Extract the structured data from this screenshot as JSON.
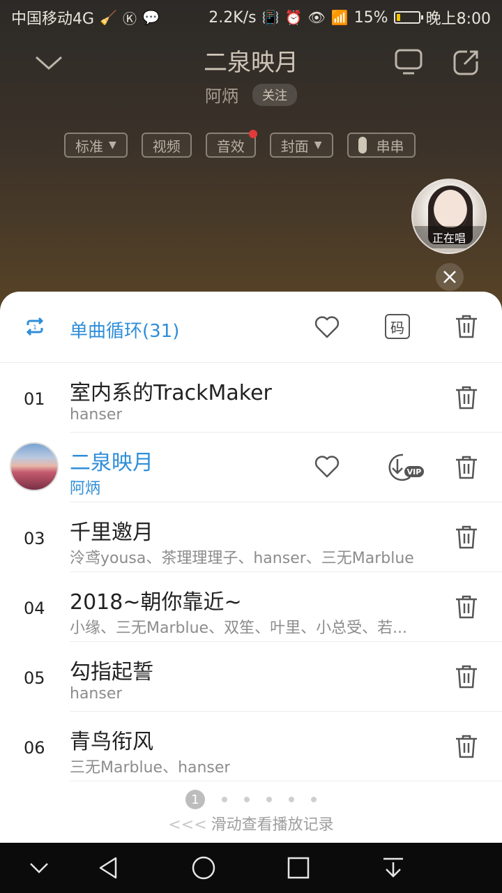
{
  "status": {
    "carrier": "中国移动4G",
    "speed": "2.2K/s",
    "battery": "15%",
    "battery_level": 0.15,
    "time": "晚上8:00"
  },
  "header": {
    "title": "二泉映月",
    "artist": "阿炳",
    "follow": "关注",
    "chips": [
      "标准",
      "视频",
      "音效",
      "封面",
      "串串"
    ]
  },
  "floating": {
    "label": "正在唱"
  },
  "playlist": {
    "mode": "单曲循环(31)",
    "code_label": "码",
    "items": [
      {
        "num": "01",
        "title": "室内系的TrackMaker",
        "artist": "hanser"
      },
      {
        "num": "",
        "title": "二泉映月",
        "artist": "阿炳",
        "vip": "VIP"
      },
      {
        "num": "03",
        "title": "千里邀月",
        "artist": "泠鸢yousa、茶理理理子、hanser、三无Marblue"
      },
      {
        "num": "04",
        "title": "2018~朝你靠近~",
        "artist": "小缘、三无Marblue、双笙、叶里、小总受、若..."
      },
      {
        "num": "05",
        "title": "勾指起誓",
        "artist": "hanser"
      },
      {
        "num": "06",
        "title": "青鸟衔风",
        "artist": "三无Marblue、hanser"
      }
    ]
  },
  "pager": {
    "current": "1"
  },
  "hint": {
    "arrows": "<<<",
    "text": "滑动查看播放记录"
  },
  "colors": {
    "accent": "#2f8ed9"
  }
}
